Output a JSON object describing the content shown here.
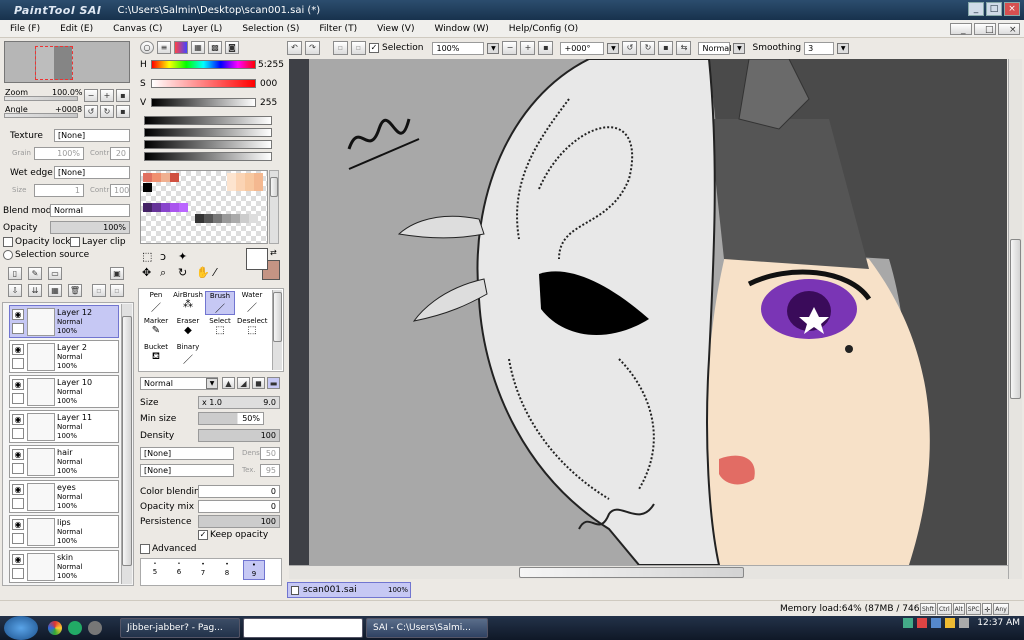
{
  "window": {
    "logo": "PaintTool SAI",
    "title": "C:\\Users\\Salmin\\Desktop\\scan001.sai (*)"
  },
  "menu": [
    "File (F)",
    "Edit (E)",
    "Canvas (C)",
    "Layer (L)",
    "Selection (S)",
    "Filter (T)",
    "View (V)",
    "Window (W)",
    "Help/Config (O)"
  ],
  "navigator": {
    "zoom_label": "Zoom",
    "zoom_value": "100.0%",
    "angle_label": "Angle",
    "angle_value": "+0008"
  },
  "tool_options_left": {
    "texture_label": "Texture",
    "texture_value": "[None]",
    "grain_label": "Grain",
    "grain_value": "100%",
    "contr_label": "Contr",
    "contr_value": "20",
    "wet_label": "Wet edge",
    "wet_value": "[None]",
    "size_label": "Size",
    "size_value": "1",
    "contr2_label": "Contr",
    "contr2_value": "100",
    "blend_label": "Blend mode",
    "blend_value": "Normal",
    "opacity_label": "Opacity",
    "opacity_value": "100%",
    "opacity_lock": "Opacity lock",
    "layer_clip": "Layer clip",
    "selection_source": "Selection source"
  },
  "layers": [
    {
      "name": "Layer 12",
      "mode": "Normal",
      "opacity": "100%",
      "selected": true
    },
    {
      "name": "Layer 2",
      "mode": "Normal",
      "opacity": "100%"
    },
    {
      "name": "Layer 10",
      "mode": "Normal",
      "opacity": "100%"
    },
    {
      "name": "Layer 11",
      "mode": "Normal",
      "opacity": "100%"
    },
    {
      "name": "hair",
      "mode": "Normal",
      "opacity": "100%"
    },
    {
      "name": "eyes",
      "mode": "Normal",
      "opacity": "100%"
    },
    {
      "name": "lips",
      "mode": "Normal",
      "opacity": "100%"
    },
    {
      "name": "skin",
      "mode": "Normal",
      "opacity": "100%"
    }
  ],
  "color": {
    "h_label": "H",
    "h_value": "5:255",
    "s_label": "S",
    "s_value": "000",
    "v_label": "V",
    "v_value": "255",
    "primary": "#ffffff",
    "secondary": "#c49484"
  },
  "brushes": [
    {
      "label": "Pen"
    },
    {
      "label": "AirBrush"
    },
    {
      "label": "Brush",
      "active": true
    },
    {
      "label": "Water"
    },
    {
      "label": "Marker"
    },
    {
      "label": "Eraser"
    },
    {
      "label": "Select"
    },
    {
      "label": "Deselect"
    },
    {
      "label": "Bucket"
    },
    {
      "label": "Binary"
    }
  ],
  "brush_settings": {
    "mode_value": "Normal",
    "size_label": "Size",
    "size_mult": "x 1.0",
    "size_value": "9.0",
    "minsize_label": "Min size",
    "minsize_value": "50%",
    "density_label": "Density",
    "density_value": "100",
    "shape1_value": "[None]",
    "dens_label": "Dens",
    "dens_value": "50",
    "shape2_value": "[None]",
    "tex_label": "Tex.",
    "tex_value": "95",
    "blending_label": "Color blending",
    "blending_value": "0",
    "mix_label": "Opacity mix",
    "mix_value": "0",
    "persist_label": "Persistence",
    "persist_value": "100",
    "keep_opacity": "Keep opacity",
    "advanced": "Advanced",
    "size_presets": [
      "5",
      "6",
      "7",
      "8",
      "9"
    ]
  },
  "canvas_toolbar": {
    "selection_label": "Selection",
    "zoom_value": "100%",
    "rotate_value": "+000°",
    "mode_value": "Normal",
    "smoothing_label": "Smoothing",
    "smoothing_value": "3"
  },
  "doc_tab": {
    "name": "scan001.sai",
    "zoom": "100%"
  },
  "status": {
    "memory": "Memory load:64% (87MB / 746MB)",
    "keys": [
      "Shft",
      "Ctrl",
      "Alt",
      "SPC",
      "Any"
    ]
  },
  "taskbar": {
    "tasks": [
      "Jibber-jabber? - Pag...",
      "",
      "SAI - C:\\Users\\Salmi..."
    ],
    "time": "12:37 AM"
  }
}
